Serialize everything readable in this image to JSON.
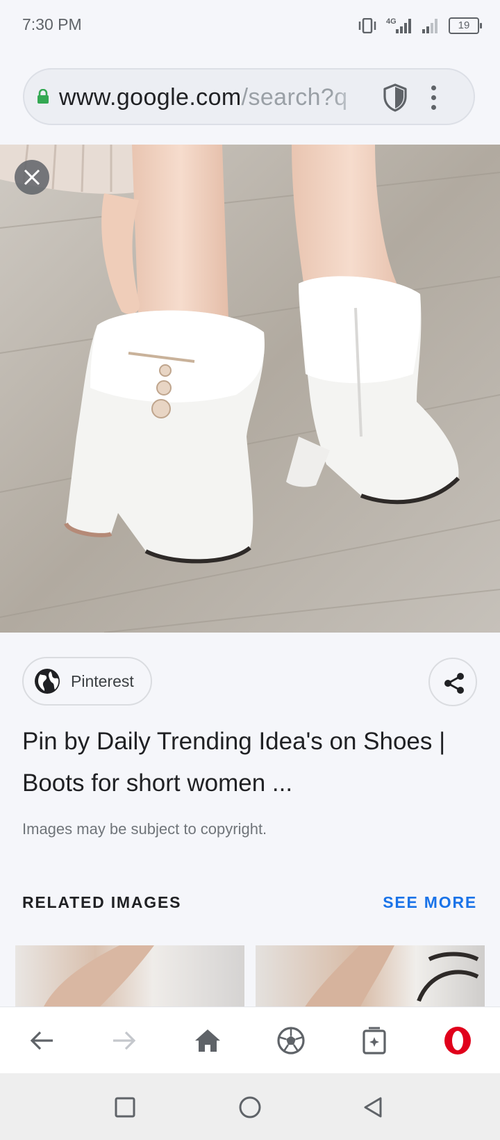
{
  "status_bar": {
    "time": "7:30 PM",
    "network": "4G",
    "battery": "19",
    "icons": [
      "vibrate-icon",
      "signal-4g-icon",
      "signal-icon",
      "battery-icon"
    ]
  },
  "browser": {
    "url_host": "www.google.com",
    "url_path": "/search?q",
    "icons": [
      "lock-icon",
      "shield-icon",
      "overflow-menu-icon"
    ]
  },
  "image_viewer": {
    "image_alt": "White faux-fur platform ankle boots with block heels",
    "close_icon": "close-icon"
  },
  "result": {
    "source": "Pinterest",
    "source_icon": "globe-icon",
    "share_icon": "share-icon",
    "title": "Pin by Daily Trending Idea's on Shoes | Boots for short women ...",
    "copyright_notice": "Images may be subject to copyright."
  },
  "related": {
    "heading": "RELATED IMAGES",
    "see_more": "SEE MORE"
  },
  "bottom_nav": {
    "items": [
      "back-icon",
      "forward-icon",
      "home-icon",
      "soccer-ball-icon",
      "tabs-icon",
      "opera-icon"
    ]
  },
  "system_nav": {
    "items": [
      "recents-icon",
      "home-circle-icon",
      "back-triangle-icon"
    ]
  },
  "colors": {
    "accent": "#1a73e8",
    "lock_green": "#34a853",
    "opera_red": "#e0001b",
    "background": "#f5f6fa"
  }
}
